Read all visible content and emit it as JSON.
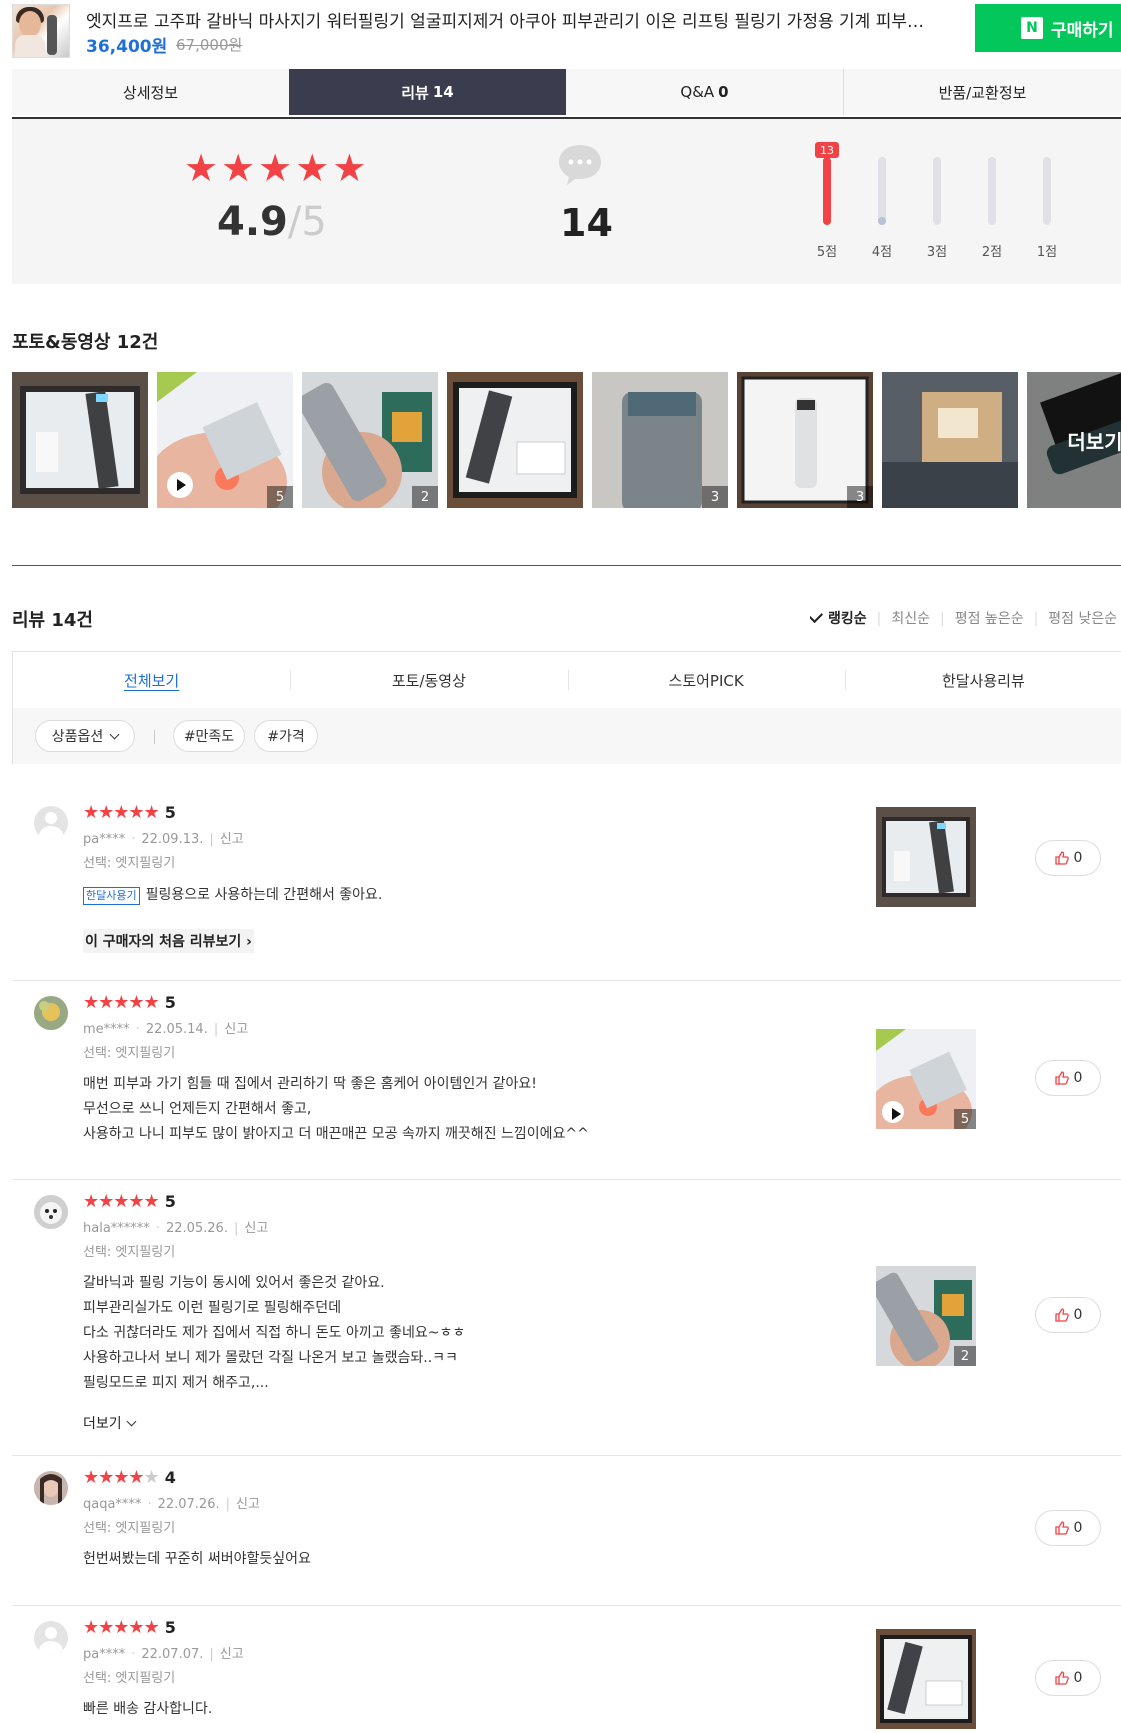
{
  "product": {
    "title": "엣지프로 고주파 갈바닉 마사지기 워터필링기 얼굴피지제거 아쿠아 피부관리기 이온 리프팅 필링기 가정용 기계 피부…",
    "price": "36,400원",
    "original_price": "67,000원",
    "buy_label": "구매하기",
    "buy_icon": "naver-n-icon"
  },
  "tabs": [
    {
      "label": "상세정보",
      "count": ""
    },
    {
      "label": "리뷰",
      "count": "14"
    },
    {
      "label": "Q&A",
      "count": "0"
    },
    {
      "label": "반품/교환정보",
      "count": ""
    }
  ],
  "summary": {
    "rating": "4.9",
    "rating_max": "/5",
    "review_count": "14",
    "distribution": [
      {
        "label": "5점",
        "count": 13,
        "badge": "13",
        "fraction": 1.0
      },
      {
        "label": "4점",
        "count": 1,
        "badge": "",
        "fraction": 0.08
      },
      {
        "label": "3점",
        "count": 0,
        "badge": "",
        "fraction": 0
      },
      {
        "label": "2점",
        "count": 0,
        "badge": "",
        "fraction": 0
      },
      {
        "label": "1점",
        "count": 0,
        "badge": "",
        "fraction": 0
      }
    ]
  },
  "photo_section": {
    "title": "포토&동영상 12건",
    "more_label": "더보기",
    "photos": [
      {
        "count": ""
      },
      {
        "count": "5",
        "video": true
      },
      {
        "count": "2"
      },
      {
        "count": ""
      },
      {
        "count": "3"
      },
      {
        "count": "3"
      },
      {
        "count": ""
      },
      {
        "count": ""
      }
    ]
  },
  "reviews_header": {
    "title": "리뷰 14건",
    "sorts": [
      "랭킹순",
      "최신순",
      "평점 높은순",
      "평점 낮은순"
    ],
    "active_sort": "랭킹순"
  },
  "filter_tabs": [
    "전체보기",
    "포토/동영상",
    "스토어PICK",
    "한달사용리뷰"
  ],
  "filter_chips": [
    "상품옵션",
    "#만족도",
    "#가격"
  ],
  "reviews": [
    {
      "score": "5",
      "stars": 5,
      "user": "pa****",
      "date": "22.09.13.",
      "report": "신고",
      "option": "선택: 엣지필링기",
      "tag": "한달사용기",
      "lines": [
        "필링용으로 사용하는데 간편해서 좋아요."
      ],
      "first_review_link": "이 구매자의 처음 리뷰보기",
      "likes": "0",
      "photo_count": ""
    },
    {
      "score": "5",
      "stars": 5,
      "user": "me****",
      "date": "22.05.14.",
      "report": "신고",
      "option": "선택: 엣지필링기",
      "lines": [
        "매번 피부과 가기 힘들 때 집에서 관리하기 딱 좋은 홈케어 아이템인거 같아요!",
        "무선으로 쓰니 언제든지 간편해서 좋고,",
        "사용하고 나니 피부도 많이 밝아지고 더 매끈매끈 모공 속까지 깨끗해진 느낌이에요^^"
      ],
      "likes": "0",
      "photo_count": "5"
    },
    {
      "score": "5",
      "stars": 5,
      "user": "hala******",
      "date": "22.05.26.",
      "report": "신고",
      "option": "선택: 엣지필링기",
      "lines": [
        "갈바닉과 필링 기능이 동시에 있어서 좋은것 같아요.",
        "피부관리실가도 이런 필링기로 필링해주던데",
        "다소 귀찮더라도 제가 집에서 직접 하니 돈도 아끼고 좋네요~ㅎㅎ",
        "사용하고나서 보니 제가 몰랐던 각질 나온거 보고 놀랬슴돠..ㅋㅋ",
        "필링모드로 피지 제거 해주고,..."
      ],
      "more_label": "더보기",
      "likes": "0",
      "photo_count": "2"
    },
    {
      "score": "4",
      "stars": 4,
      "user": "qaqa****",
      "date": "22.07.26.",
      "report": "신고",
      "option": "선택: 엣지필링기",
      "lines": [
        "헌번써봤는데 꾸준히 써버야할듯싶어요"
      ],
      "likes": "0"
    },
    {
      "score": "5",
      "stars": 5,
      "user": "pa****",
      "date": "22.07.07.",
      "report": "신고",
      "option": "선택: 엣지필링기",
      "lines": [
        "빠른 배송 감사합니다."
      ],
      "likes": "0",
      "photo_count": ""
    }
  ],
  "colors": {
    "accent_blue": "#1e6fd9",
    "star_red": "#f24245",
    "buy_green": "#03c75a",
    "active_tab": "#3b3d4e"
  }
}
